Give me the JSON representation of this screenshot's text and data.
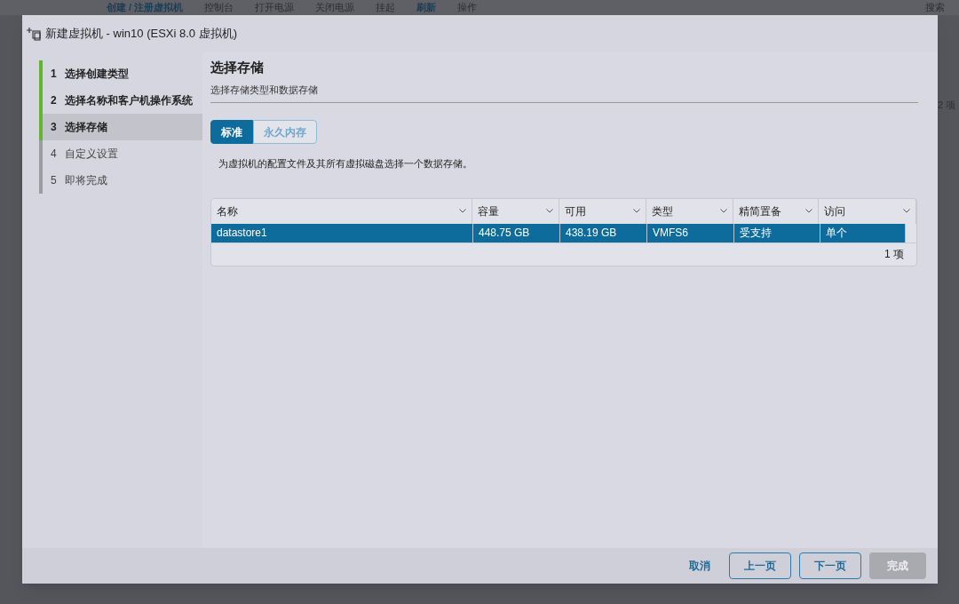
{
  "background": {
    "toolbar": [
      {
        "label": "创建 / 注册虚拟机",
        "kind": "link"
      },
      {
        "label": "控制台",
        "kind": "plain"
      },
      {
        "label": "打开电源",
        "kind": "plain"
      },
      {
        "label": "关闭电源",
        "kind": "plain"
      },
      {
        "label": "挂起",
        "kind": "plain"
      },
      {
        "label": "刷新",
        "kind": "link"
      },
      {
        "label": "操作",
        "kind": "plain"
      }
    ],
    "search": "搜索",
    "count": "2 项"
  },
  "dialog": {
    "title": "新建虚拟机 - win10 (ESXi 8.0 虚拟机)",
    "steps": [
      {
        "number": "1",
        "label": "选择创建类型",
        "completed": true,
        "selected": false
      },
      {
        "number": "2",
        "label": "选择名称和客户机操作系统",
        "completed": true,
        "selected": false
      },
      {
        "number": "3",
        "label": "选择存储",
        "completed": true,
        "selected": true
      },
      {
        "number": "4",
        "label": "自定义设置",
        "completed": false,
        "selected": false
      },
      {
        "number": "5",
        "label": "即将完成",
        "completed": false,
        "selected": false
      }
    ],
    "heading": "选择存储",
    "subheading": "选择存储类型和数据存储",
    "tabs": [
      {
        "label": "标准",
        "selected": true
      },
      {
        "label": "永久内存",
        "selected": false
      }
    ],
    "description": "为虚拟机的配置文件及其所有虚拟磁盘选择一个数据存储。",
    "table": {
      "columns": [
        "名称",
        "容量",
        "可用",
        "类型",
        "精简置备",
        "访问"
      ],
      "rows": [
        {
          "cells": [
            "datastore1",
            "448.75 GB",
            "438.19 GB",
            "VMFS6",
            "受支持",
            "单个"
          ],
          "selected": true
        }
      ],
      "footer": "1 项"
    },
    "buttons": [
      {
        "label": "取消",
        "kind": "link",
        "disabled": false
      },
      {
        "label": "上一页",
        "kind": "outline",
        "disabled": false
      },
      {
        "label": "下一页",
        "kind": "outline",
        "disabled": false
      },
      {
        "label": "完成",
        "kind": "primary",
        "disabled": true
      }
    ]
  }
}
